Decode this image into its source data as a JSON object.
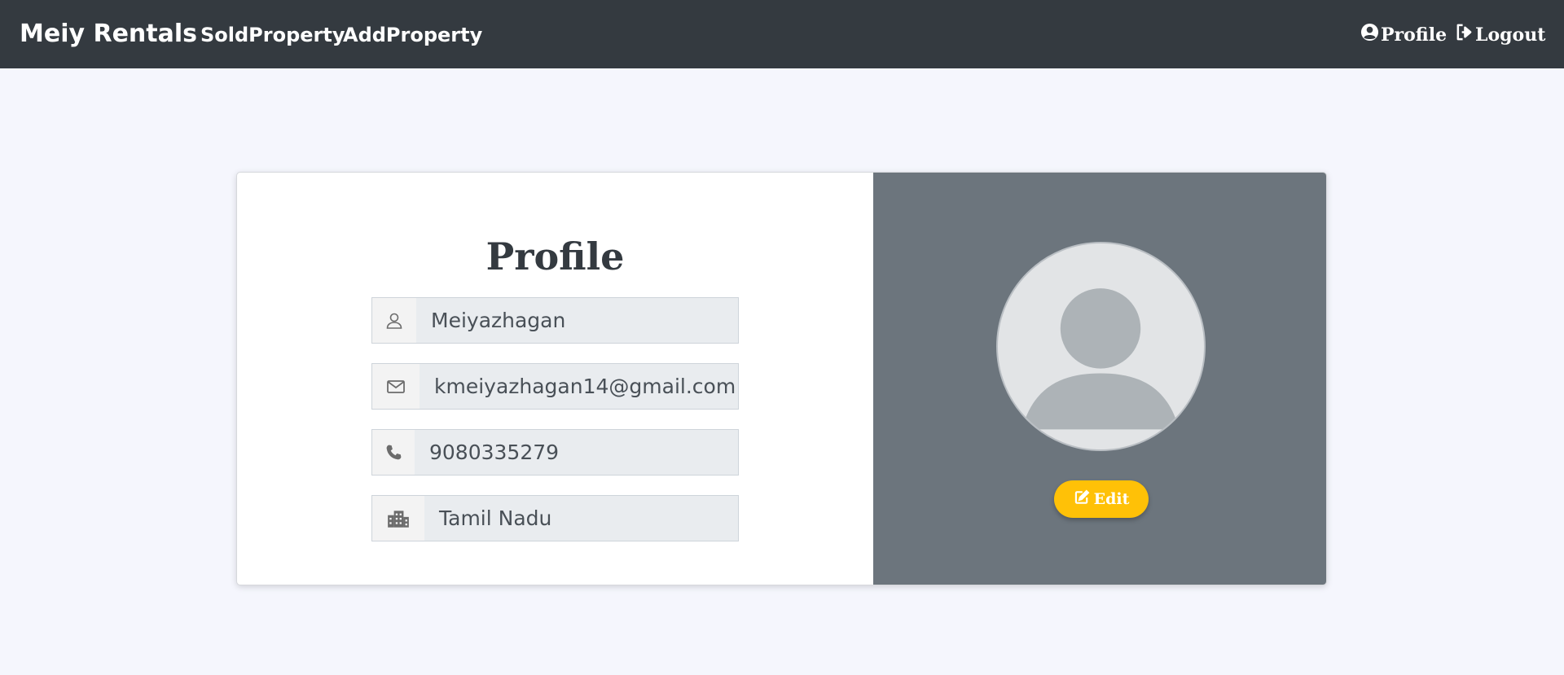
{
  "navbar": {
    "brand": "Meiy Rentals",
    "links": [
      {
        "label": "SoldProperty"
      },
      {
        "label": "AddProperty"
      }
    ],
    "profile_label": "Profile",
    "logout_label": "Logout"
  },
  "profile": {
    "title": "Profile",
    "fields": [
      {
        "icon": "user-icon",
        "value": "Meiyazhagan"
      },
      {
        "icon": "envelope-icon",
        "value": "kmeiyazhagan14@gmail.com"
      },
      {
        "icon": "phone-icon",
        "value": "9080335279"
      },
      {
        "icon": "building-icon",
        "value": "Tamil Nadu"
      }
    ],
    "avatar_icon": "default-avatar-icon",
    "edit_label": "Edit"
  },
  "colors": {
    "navbar_bg": "#343a40",
    "page_bg": "#f5f6fd",
    "right_pane_bg": "#6c757d",
    "edit_button": "#ffc107"
  }
}
